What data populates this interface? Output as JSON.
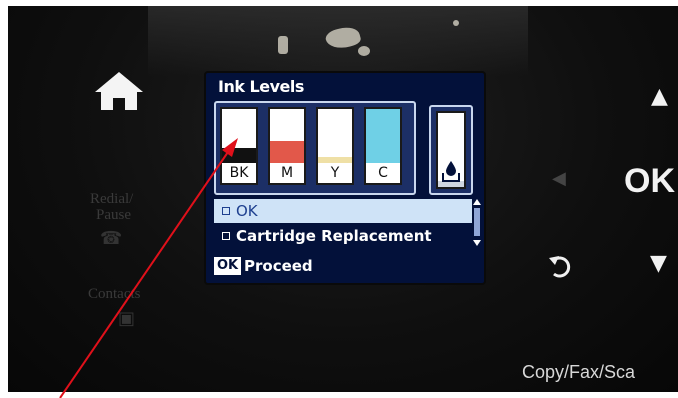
{
  "lcd": {
    "title": "Ink Levels",
    "cartridges": [
      {
        "label": "BK",
        "fill_color": "#111111",
        "level": 0.27
      },
      {
        "label": "M",
        "fill_color": "#e2584a",
        "level": 0.4
      },
      {
        "label": "Y",
        "fill_color": "#efe0a6",
        "level": 0.12
      },
      {
        "label": "C",
        "fill_color": "#6fd0e6",
        "level": 1.0
      }
    ],
    "maintenance_box": {
      "icon": "ink-drop-box-icon",
      "level": 0.08
    },
    "menu": [
      {
        "label": "OK",
        "selected": true
      },
      {
        "label": "Cartridge Replacement",
        "selected": false
      }
    ],
    "footer": {
      "badge": "OK",
      "label": "Proceed"
    }
  },
  "left_panel": {
    "icon": "home-icon",
    "redial_label": "Redial/",
    "pause_label": "Pause",
    "contacts_label": "Contacts"
  },
  "right_panel": {
    "up_arrow": "▲",
    "left_arrow": "◀",
    "ok_label": "OK",
    "down_arrow": "▼",
    "back_icon": "back-icon",
    "mode_label": "Copy/Fax/Sca"
  },
  "annotation": {
    "color": "#e0101a",
    "icon": "red-arrow"
  },
  "colors": {
    "lcd_background": "#03113a",
    "highlight": "#cfe3f7"
  }
}
